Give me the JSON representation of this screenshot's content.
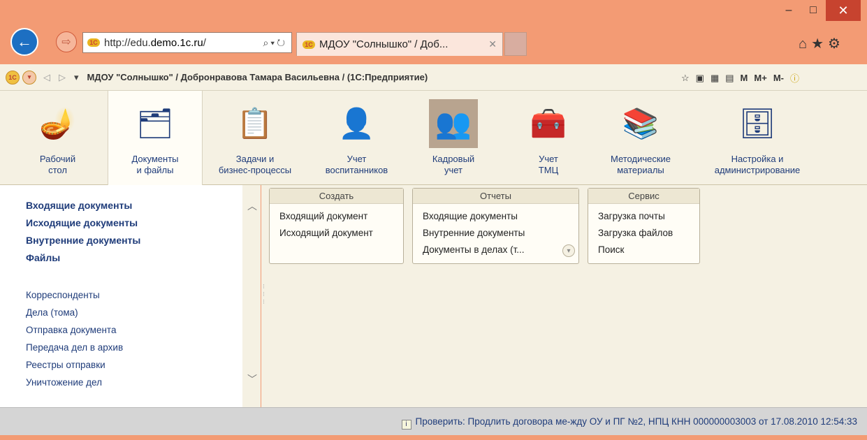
{
  "window": {
    "minimize_glyph": "–",
    "maximize_glyph": "□",
    "close_glyph": "✕"
  },
  "browser": {
    "address": "http://edu.demo.1c.ru/",
    "address_host": "http://edu.",
    "address_bold": "demo.1c.ru",
    "address_tail": "/",
    "tab_title": "МДОУ \"Солнышко\" / Доб...",
    "right_icons": [
      "home-icon",
      "favorites-star-icon",
      "settings-gear-icon"
    ]
  },
  "toolbar1c": {
    "title": "МДОУ \"Солнышко\" / Добронравова Тамара Васильевна / (1С:Предприятие)",
    "right_items": [
      "М",
      "М+",
      "М-"
    ]
  },
  "sections": [
    {
      "label": "Рабочий стол",
      "line1": "Рабочий",
      "line2": "стол",
      "icon": "desk-lamp-icon"
    },
    {
      "label": "Документы и файлы",
      "line1": "Документы",
      "line2": "и файлы",
      "icon": "folder-icon",
      "active": true
    },
    {
      "label": "Задачи и бизнес-процессы",
      "line1": "Задачи и",
      "line2": "бизнес-процессы",
      "icon": "clipboard-icon"
    },
    {
      "label": "Учет воспитанников",
      "line1": "Учет",
      "line2": "воспитанников",
      "icon": "person-icon"
    },
    {
      "label": "Кадровый учет",
      "line1": "Кадровый",
      "line2": "учет",
      "icon": "people-icon"
    },
    {
      "label": "Учет ТМЦ",
      "line1": "Учет",
      "line2": "ТМЦ",
      "icon": "toolbox-icon"
    },
    {
      "label": "Методические материалы",
      "line1": "Методические",
      "line2": "материалы",
      "icon": "books-icon"
    },
    {
      "label": "Настройка и администрирование",
      "line1": "Настройка и",
      "line2": "администрирование",
      "icon": "database-icon"
    }
  ],
  "leftnav": {
    "bold_items": [
      "Входящие документы",
      "Исходящие документы",
      "Внутренние документы",
      "Файлы"
    ],
    "items": [
      "Корреспонденты",
      "Дела (тома)",
      "Отправка документа",
      "Передача дел в архив",
      "Реестры отправки",
      "Уничтожение дел"
    ]
  },
  "groups": {
    "create": {
      "title": "Создать",
      "items": [
        "Входящий документ",
        "Исходящий документ"
      ]
    },
    "reports": {
      "title": "Отчеты",
      "items": [
        "Входящие документы",
        "Внутренние документы",
        "Документы в делах (т..."
      ]
    },
    "service": {
      "title": "Сервис",
      "items": [
        "Загрузка почты",
        "Загрузка файлов",
        "Поиск"
      ]
    }
  },
  "status": {
    "message": "Проверить: Продлить договора ме-жду ОУ и ПГ №2, НПЦ КНН 000000003003 от 17.08.2010 12:54:33"
  }
}
